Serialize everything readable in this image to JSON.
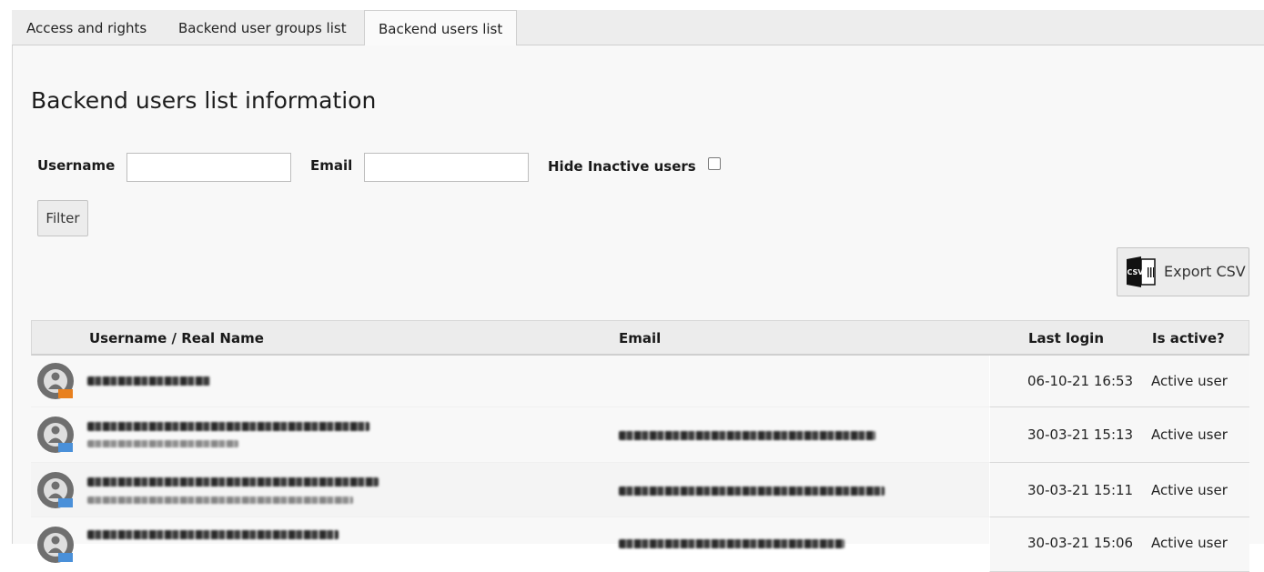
{
  "tabs": [
    {
      "label": "Access and rights"
    },
    {
      "label": "Backend user groups list"
    },
    {
      "label": "Backend users list"
    }
  ],
  "page_title": "Backend users list information",
  "filters": {
    "username_label": "Username",
    "username_value": "",
    "email_label": "Email",
    "email_value": "",
    "hide_inactive_label": "Hide Inactive users",
    "hide_inactive_checked": false,
    "filter_button": "Filter"
  },
  "export": {
    "label": "Export CSV",
    "icon": "csv-file-icon",
    "icon_text": "CSV"
  },
  "table": {
    "columns": {
      "name": "Username / Real Name",
      "email": "Email",
      "last_login": "Last login",
      "active": "Is active?"
    },
    "rows": [
      {
        "last_login": "06-10-21 16:53",
        "status": "Active user",
        "avatar": "admin-user-avatar-icon"
      },
      {
        "last_login": "30-03-21 15:13",
        "status": "Active user",
        "avatar": "user-avatar-icon"
      },
      {
        "last_login": "30-03-21 15:11",
        "status": "Active user",
        "avatar": "user-avatar-icon"
      },
      {
        "last_login": "30-03-21 15:06",
        "status": "Active user",
        "avatar": "user-avatar-icon"
      }
    ]
  },
  "colors": {
    "admin_badge": "#e8801e",
    "user_badge": "#4a90d9",
    "avatar_gray": "#6f6f6f"
  }
}
